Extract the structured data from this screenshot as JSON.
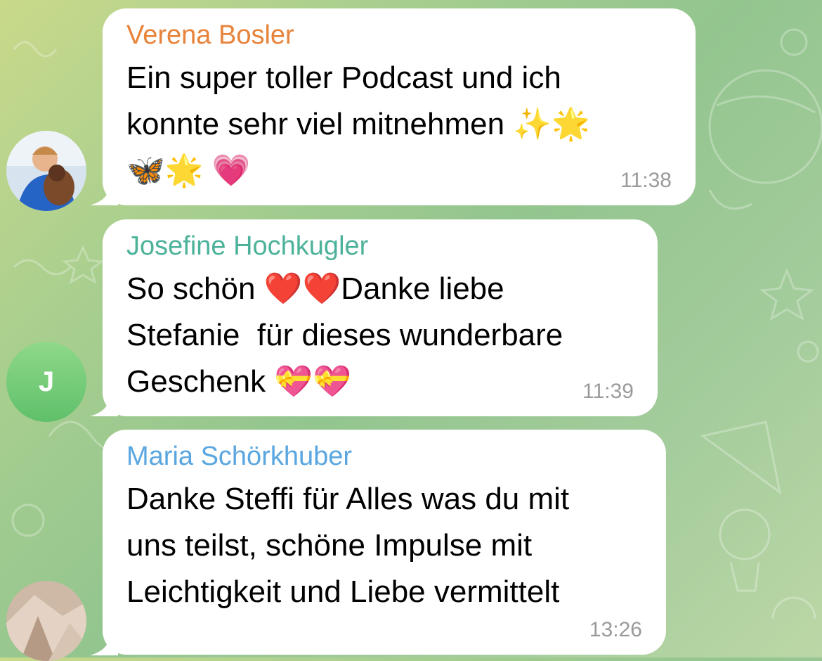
{
  "messages": [
    {
      "sender": "Verena Bosler",
      "sender_color": "#e8833a",
      "text": "Ein super toller Podcast und ich\nkonnte sehr viel mitnehmen ✨🌟\n🦋🌟 💗",
      "time": "11:38",
      "avatar": "photo-boy-with-dog"
    },
    {
      "sender": "Josefine Hochkugler",
      "sender_color": "#4db29a",
      "text": "So schön ❤️❤️Danke liebe\nStefanie  für dieses wunderbare\nGeschenk 💝💝",
      "time": "11:39",
      "avatar_initial": "J",
      "avatar_color": "#6cc86f"
    },
    {
      "sender": "Maria Schörkhuber",
      "sender_color": "#5aa6e0",
      "text": "Danke Steffi für Alles was du mit\nuns teilst, schöne Impulse mit\nLeichtigkeit und Liebe vermittelt",
      "time": "13:26",
      "avatar": "photo-crystal"
    }
  ]
}
